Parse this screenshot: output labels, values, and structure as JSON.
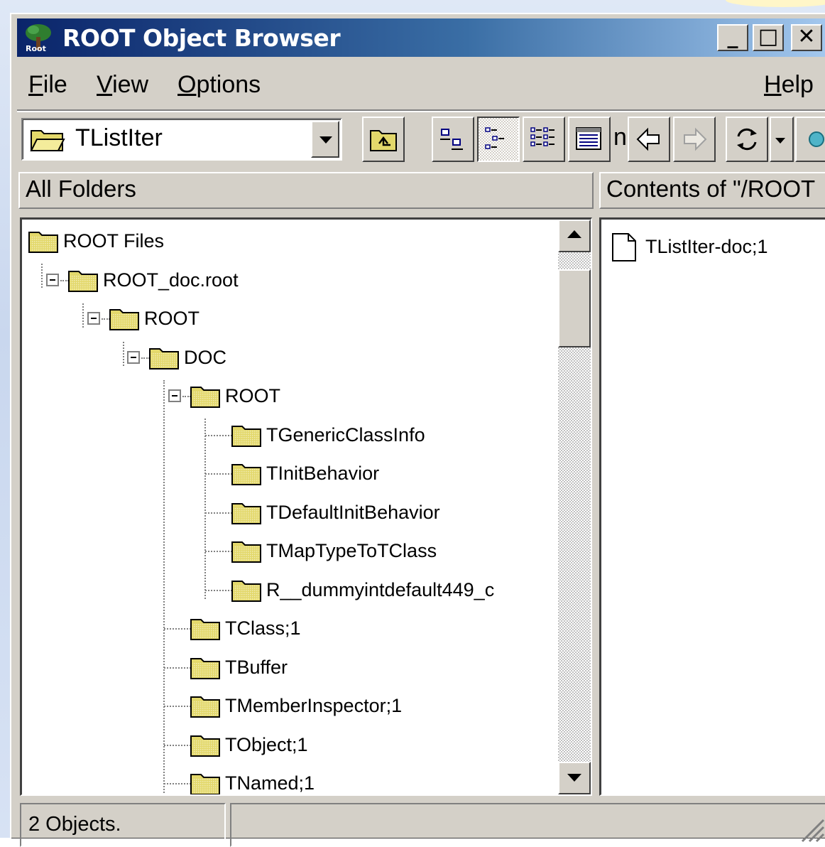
{
  "window": {
    "title": "ROOT Object Browser",
    "minimize_label": "_",
    "maximize_label": "□",
    "close_label": "✕"
  },
  "menu": {
    "file": {
      "accel": "F",
      "rest": "ile"
    },
    "view": {
      "accel": "V",
      "rest": "iew"
    },
    "options": {
      "accel": "O",
      "rest": "ptions"
    },
    "help": {
      "accel": "H",
      "rest": "elp"
    }
  },
  "toolbar": {
    "location_value": "TListIter",
    "partial_label": "n"
  },
  "left_panel": {
    "header": "All Folders",
    "tree": [
      {
        "label": "ROOT Files",
        "expanded": true
      },
      {
        "label": "ROOT_doc.root",
        "expanded": true
      },
      {
        "label": "ROOT",
        "expanded": true
      },
      {
        "label": "DOC",
        "expanded": true
      },
      {
        "label": "ROOT",
        "expanded": true
      },
      {
        "label": "TGenericClassInfo"
      },
      {
        "label": "TInitBehavior"
      },
      {
        "label": "TDefaultInitBehavior"
      },
      {
        "label": "TMapTypeToTClass"
      },
      {
        "label": "R__dummyintdefault449_c"
      },
      {
        "label": "TClass;1"
      },
      {
        "label": "TBuffer"
      },
      {
        "label": "TMemberInspector;1"
      },
      {
        "label": "TObject;1"
      },
      {
        "label": "TNamed;1"
      }
    ]
  },
  "right_panel": {
    "header": "Contents of \"/ROOT",
    "items": [
      {
        "label": "TListIter-doc;1",
        "icon": "document-icon"
      }
    ]
  },
  "status": {
    "objects": "2 Objects.",
    "secondary": ""
  },
  "colors": {
    "title_gradient_start": "#0a246a",
    "title_gradient_end": "#a6caf0",
    "face": "#d4d0c8",
    "folder": "#e3d86b"
  }
}
